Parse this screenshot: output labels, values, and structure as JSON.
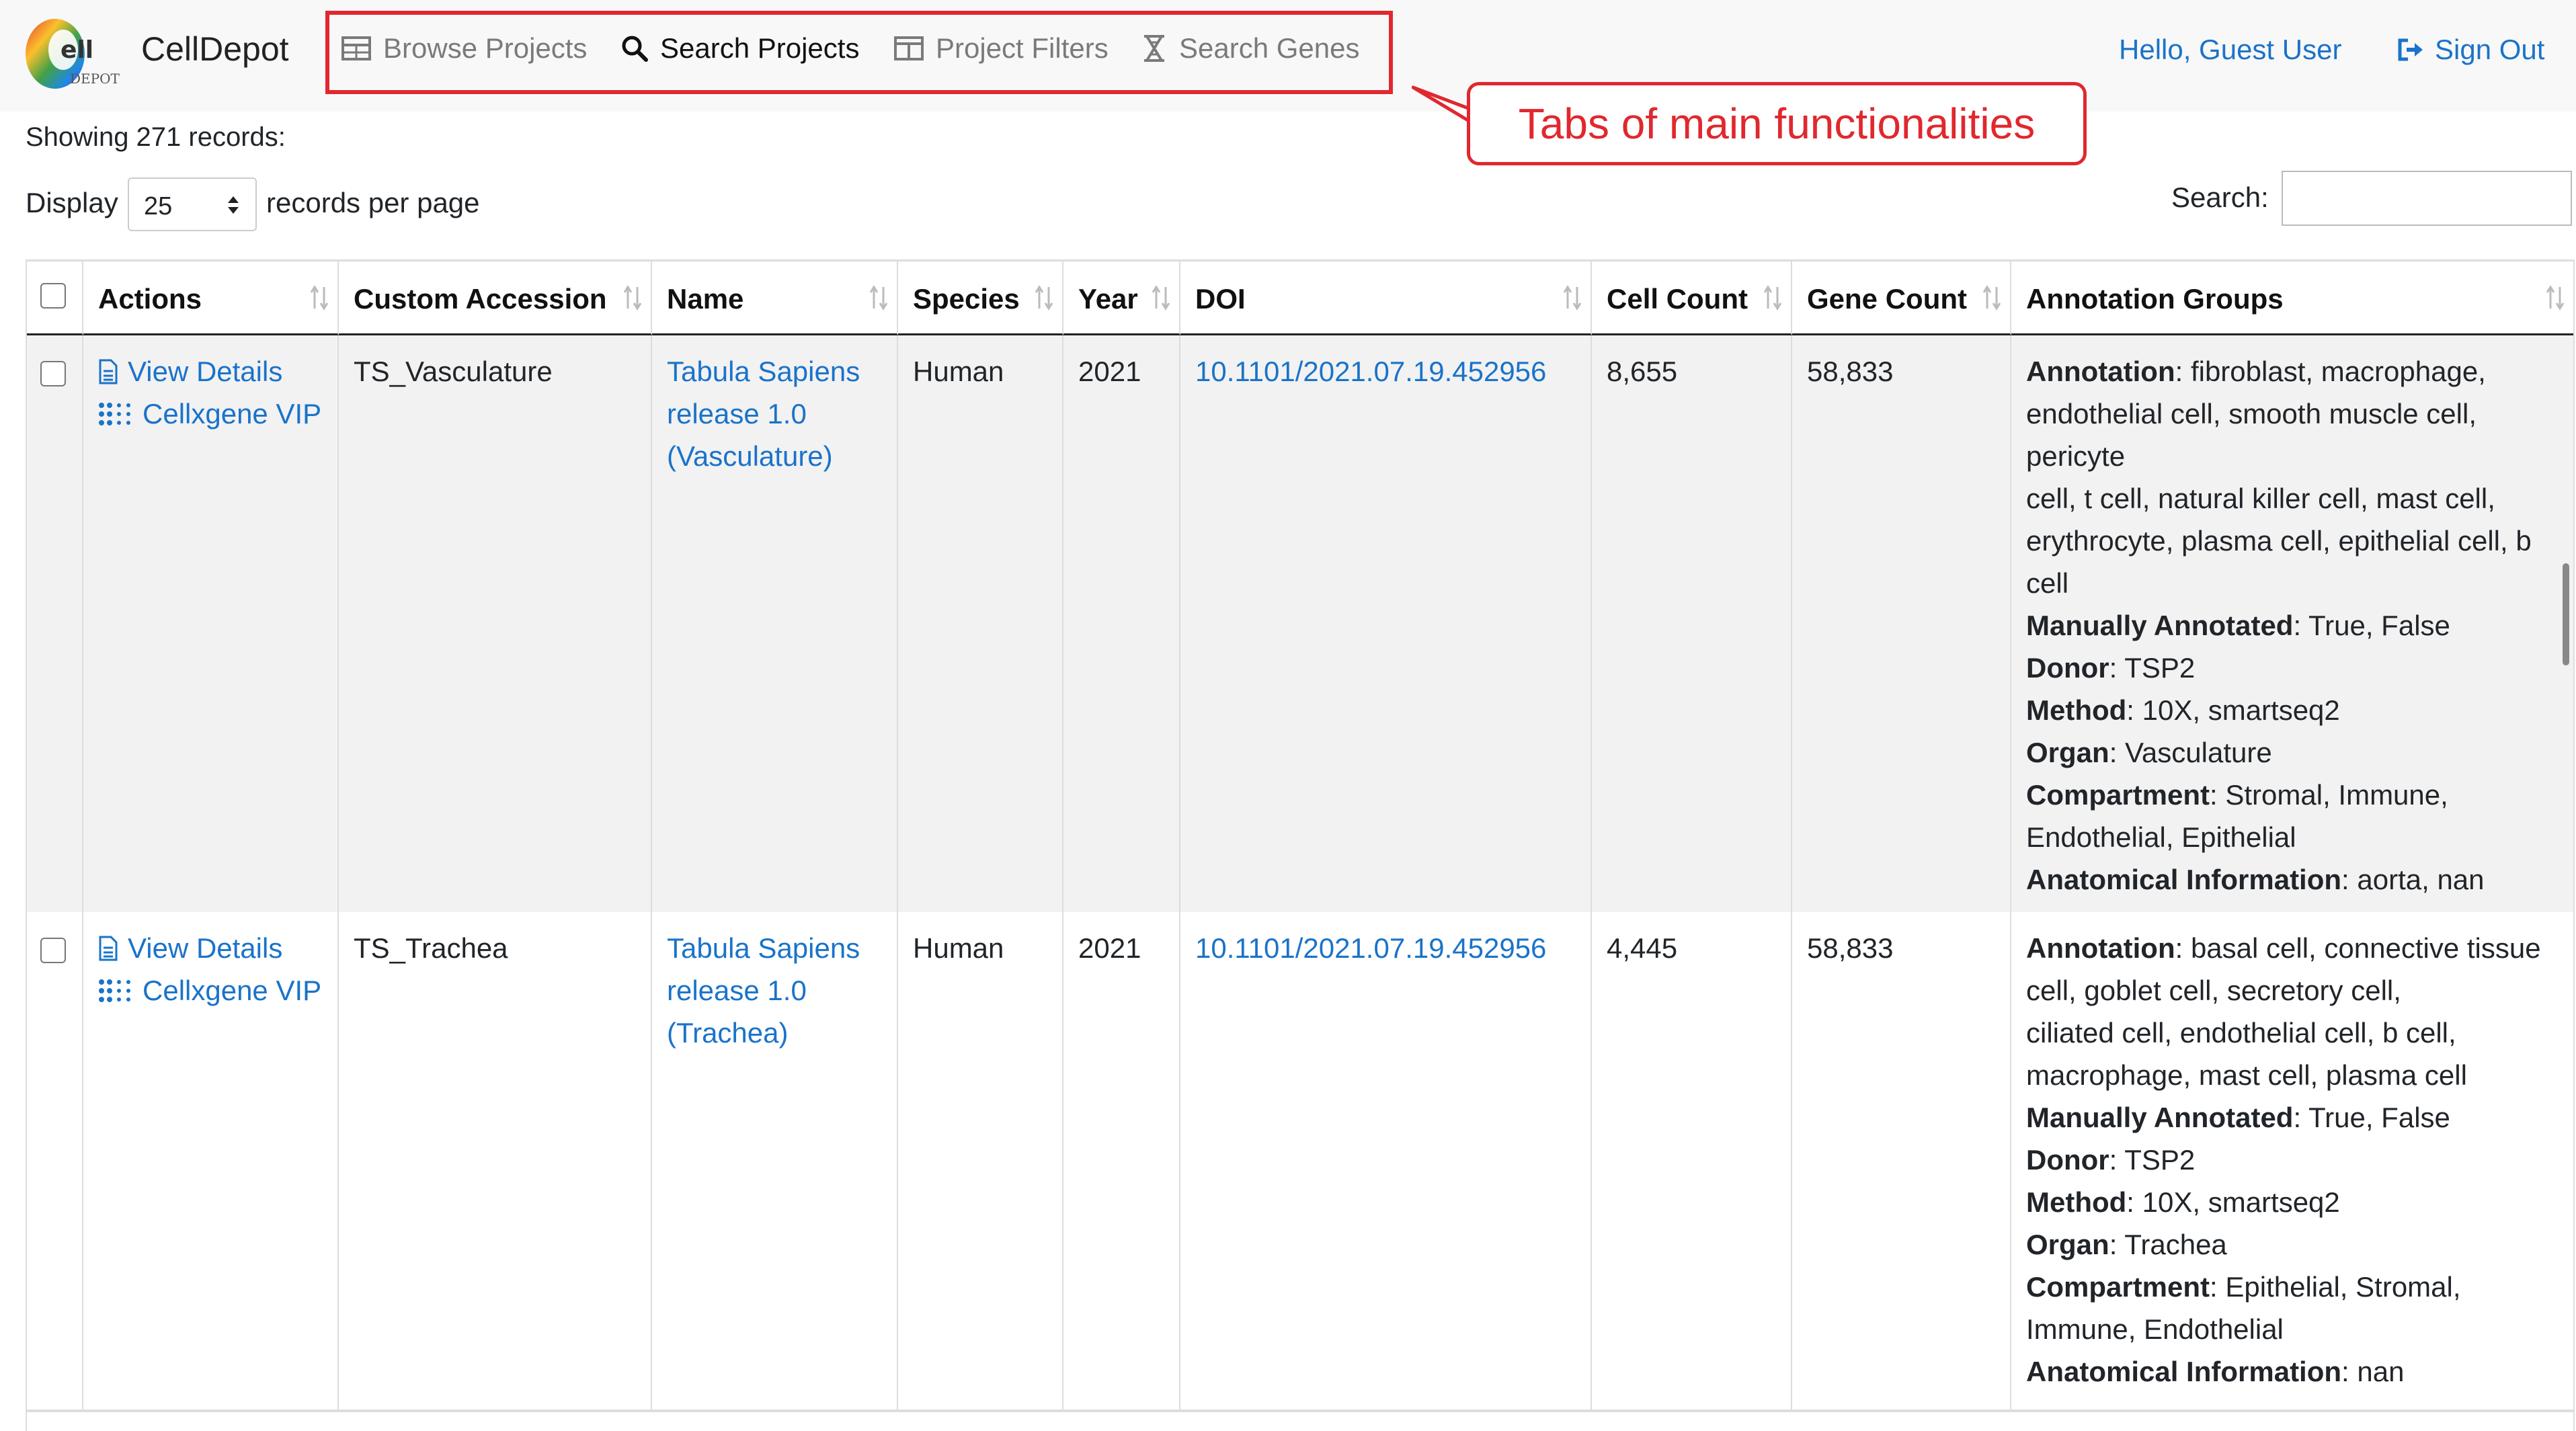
{
  "brand": {
    "name": "CellDepot"
  },
  "nav": {
    "tabs": [
      {
        "label": "Browse Projects",
        "icon": "table-icon",
        "active": false
      },
      {
        "label": "Search Projects",
        "icon": "search-icon",
        "active": true
      },
      {
        "label": "Project Filters",
        "icon": "columns-icon",
        "active": false
      },
      {
        "label": "Search Genes",
        "icon": "hourglass-icon",
        "active": false
      }
    ],
    "greeting": "Hello, Guest User",
    "sign_out": "Sign Out"
  },
  "annotation": {
    "callout": "Tabs of main functionalities",
    "color": "#e0282e"
  },
  "controls": {
    "showing": "Showing 271 records:",
    "display_label": "Display",
    "page_size": "25",
    "per_page_label": "records per page",
    "search_label": "Search:",
    "search_value": ""
  },
  "table": {
    "headers": [
      "Actions",
      "Custom Accession",
      "Name",
      "Species",
      "Year",
      "DOI",
      "Cell Count",
      "Gene Count",
      "Annotation Groups"
    ],
    "rows": [
      {
        "actions": [
          "View Details",
          "Cellxgene VIP"
        ],
        "accession": "TS_Vasculature",
        "name": [
          "Tabula Sapiens",
          "release 1.0",
          "(Vasculature)"
        ],
        "species": "Human",
        "year": "2021",
        "doi": "10.1101/2021.07.19.452956",
        "cell_count": "8,655",
        "gene_count": "58,833",
        "annotation_groups": [
          {
            "key": "Annotation",
            "lines": [
              ": fibroblast, macrophage,",
              "endothelial cell, smooth muscle cell,",
              "pericyte",
              "cell, t cell, natural killer cell, mast cell,",
              "erythrocyte, plasma cell, epithelial cell, b",
              "cell"
            ]
          },
          {
            "key": "Manually Annotated",
            "lines": [
              ": True, False"
            ]
          },
          {
            "key": "Donor",
            "lines": [
              ": TSP2"
            ]
          },
          {
            "key": "Method",
            "lines": [
              ": 10X, smartseq2"
            ]
          },
          {
            "key": "Organ",
            "lines": [
              ": Vasculature"
            ]
          },
          {
            "key": "Compartment",
            "lines": [
              ": Stromal, Immune,",
              "Endothelial, Epithelial"
            ]
          },
          {
            "key": "Anatomical Information",
            "lines": [
              ": aorta, nan"
            ]
          }
        ]
      },
      {
        "actions": [
          "View Details",
          "Cellxgene VIP"
        ],
        "accession": "TS_Trachea",
        "name": [
          "Tabula Sapiens",
          "release 1.0",
          "(Trachea)"
        ],
        "species": "Human",
        "year": "2021",
        "doi": "10.1101/2021.07.19.452956",
        "cell_count": "4,445",
        "gene_count": "58,833",
        "annotation_groups": [
          {
            "key": "Annotation",
            "lines": [
              ": basal cell, connective tissue",
              "cell, goblet cell, secretory cell,",
              "ciliated cell, endothelial cell, b cell,",
              "macrophage, mast cell, plasma cell"
            ]
          },
          {
            "key": "Manually Annotated",
            "lines": [
              ": True, False"
            ]
          },
          {
            "key": "Donor",
            "lines": [
              ": TSP2"
            ]
          },
          {
            "key": "Method",
            "lines": [
              ": 10X, smartseq2"
            ]
          },
          {
            "key": "Organ",
            "lines": [
              ": Trachea"
            ]
          },
          {
            "key": "Compartment",
            "lines": [
              ": Epithelial, Stromal,",
              "Immune, Endothelial"
            ]
          },
          {
            "key": "Anatomical Information",
            "lines": [
              ": nan"
            ]
          }
        ]
      }
    ]
  },
  "colors": {
    "link": "#1a73c9",
    "navbar_bg": "#f8f8f8",
    "row_alt": "#f2f2f2"
  }
}
